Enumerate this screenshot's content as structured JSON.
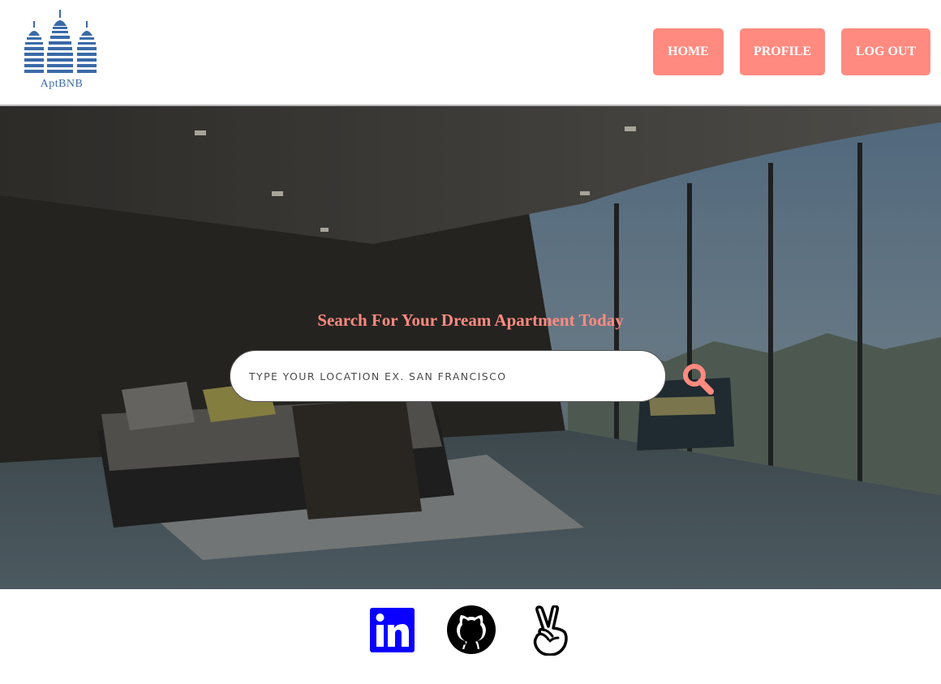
{
  "brand": {
    "name": "AptBNB"
  },
  "nav": {
    "home_label": "HOME",
    "profile_label": "PROFILE",
    "logout_label": "LOG OUT",
    "button_color": "#ff8a80"
  },
  "hero": {
    "title": "Search For Your Dream Apartment Today",
    "search": {
      "placeholder": "TYPE YOUR LOCATION EX. SAN FRANCISCO",
      "value": ""
    },
    "search_icon": "search-icon",
    "accent_color": "#ff8a80"
  },
  "footer": {
    "socials": [
      {
        "icon": "linkedin-icon",
        "color": "#0a00ff"
      },
      {
        "icon": "github-icon",
        "color": "#000000"
      },
      {
        "icon": "angellist-icon",
        "color": "#000000"
      }
    ]
  }
}
